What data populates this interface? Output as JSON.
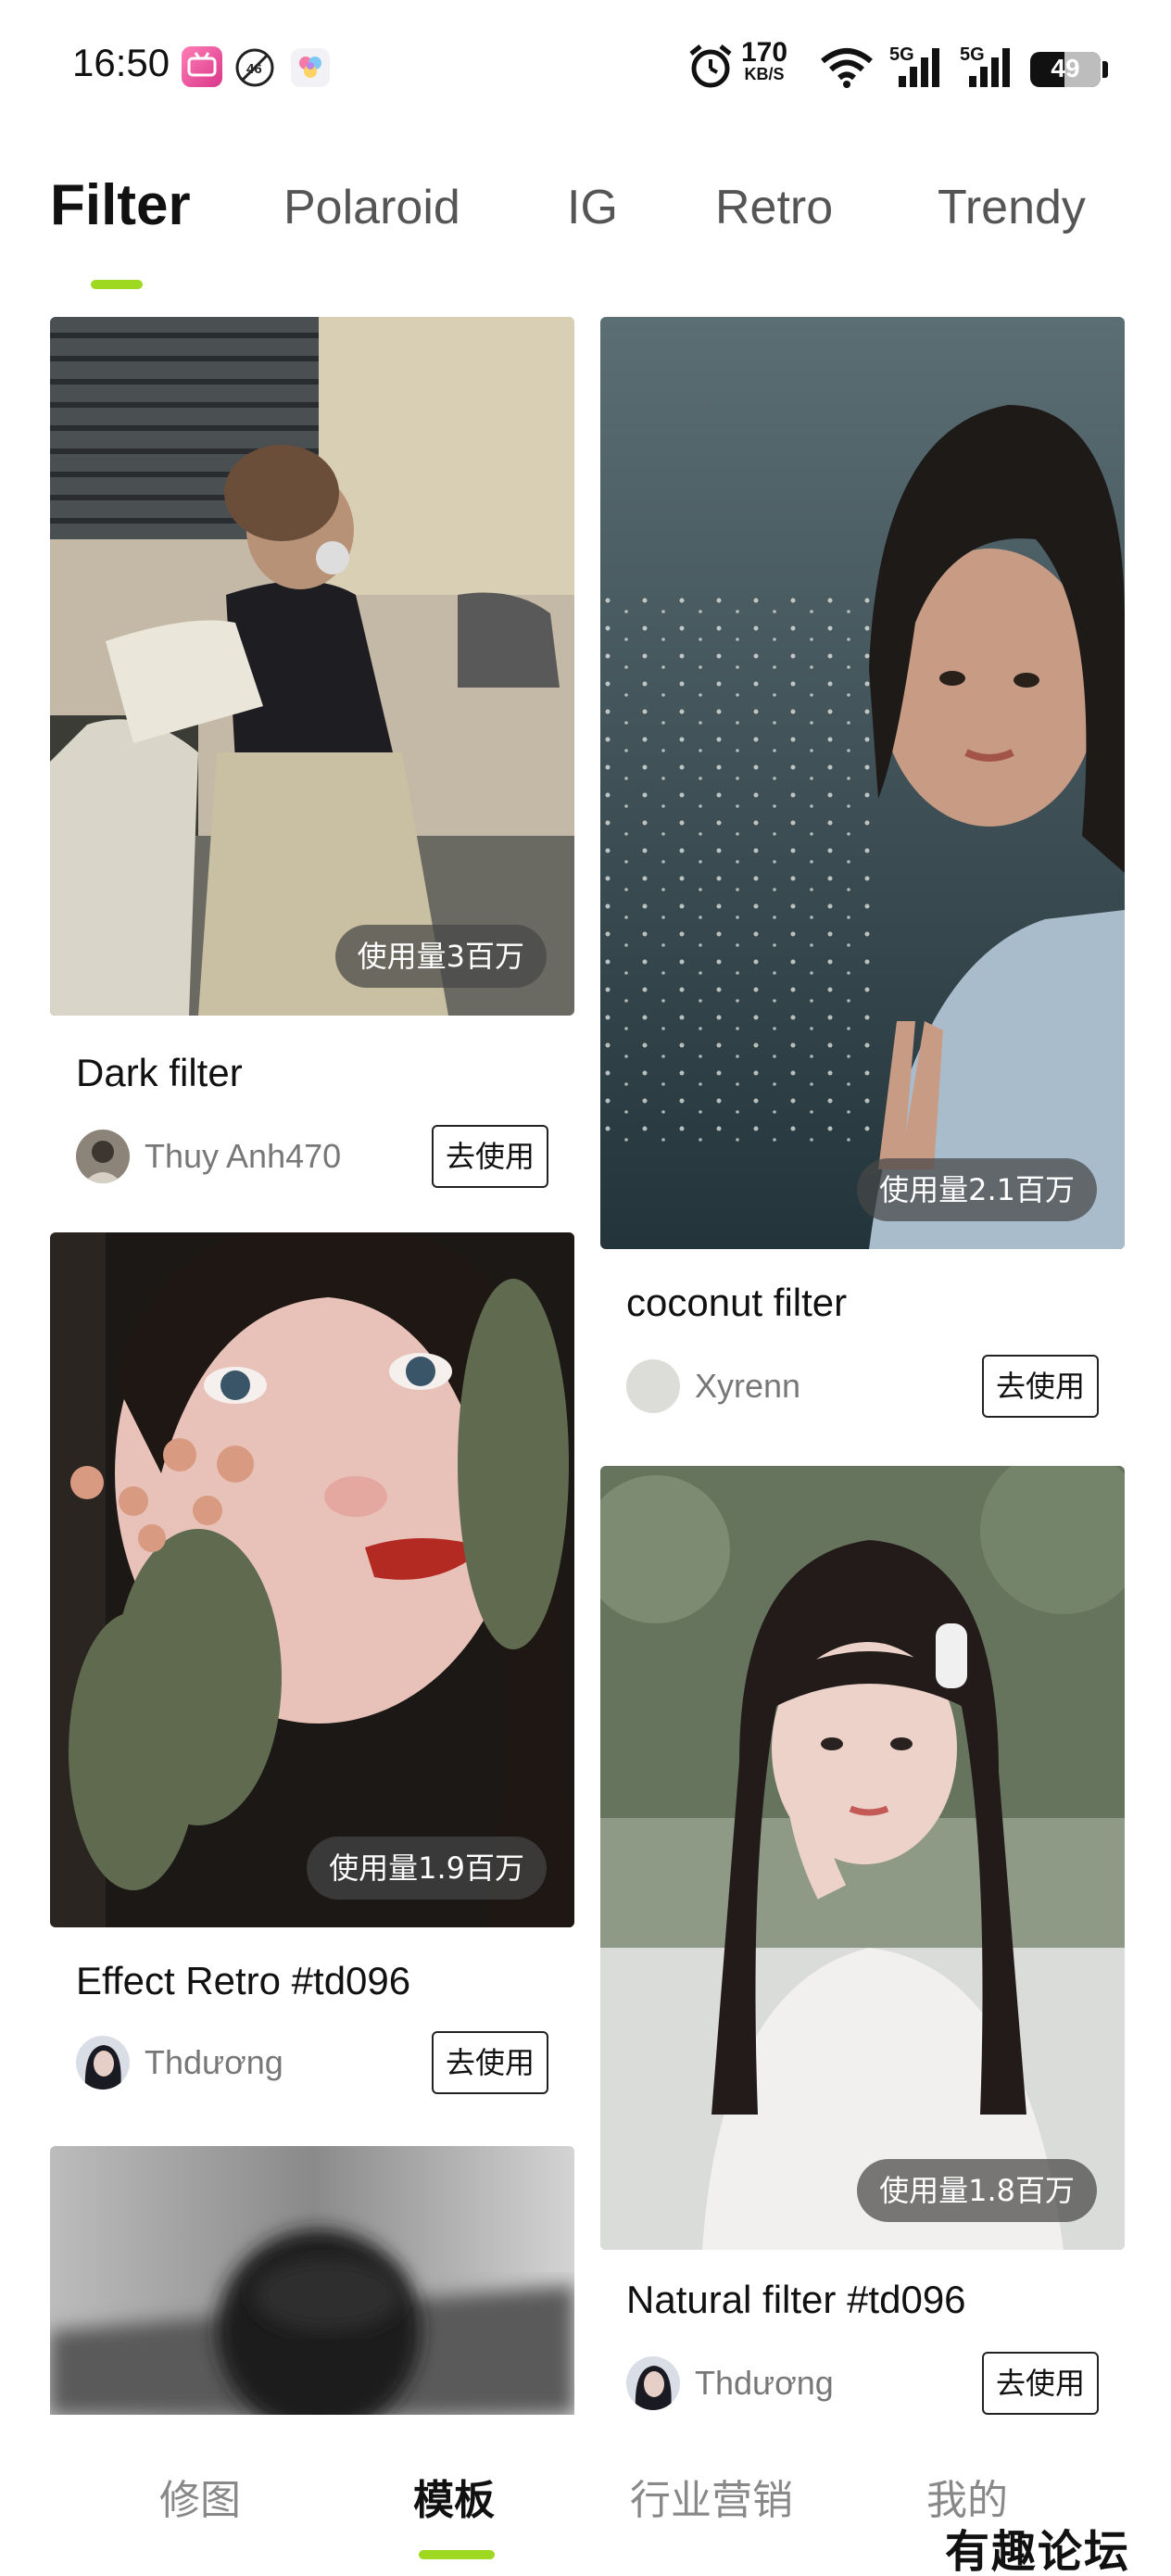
{
  "status_bar": {
    "time": "16:50",
    "net_speed": "170",
    "net_unit": "KB/S",
    "signal1_label": "5G",
    "signal2_label": "5G",
    "battery": "49",
    "battery_level": 0.49
  },
  "tabs": [
    {
      "label": "Filter",
      "active": true
    },
    {
      "label": "Polaroid",
      "active": false
    },
    {
      "label": "IG",
      "active": false
    },
    {
      "label": "Retro",
      "active": false
    },
    {
      "label": "Trendy",
      "active": false
    }
  ],
  "cards": [
    {
      "usage": "使用量3百万",
      "title": "Dark filter",
      "author": "Thuy Anh470",
      "button": "去使用"
    },
    {
      "usage": "使用量2.1百万",
      "title": "coconut filter",
      "author": "Xyrenn",
      "button": "去使用"
    },
    {
      "usage": "使用量1.9百万",
      "title": "Effect Retro  #td096",
      "author": "Thdương",
      "button": "去使用"
    },
    {
      "usage": "使用量1.8百万",
      "title": "Natural filter  #td096",
      "author": "Thdương",
      "button": "去使用"
    }
  ],
  "bottom_nav": [
    {
      "label": "修图",
      "active": false
    },
    {
      "label": "模板",
      "active": true
    },
    {
      "label": "行业营销",
      "active": false
    },
    {
      "label": "我的",
      "active": false
    }
  ],
  "watermark": "有趣论坛",
  "colors": {
    "accent": "#9ed821"
  }
}
